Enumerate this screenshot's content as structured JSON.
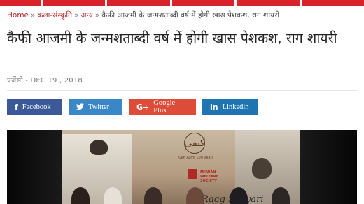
{
  "breadcrumb": {
    "items": [
      "Home",
      "कला-संस्कृति",
      "अन्य",
      "कैफी आजमी के जन्मशताब्दी वर्ष में होगी खास पेशकश, राग शायरी"
    ],
    "separator": "»"
  },
  "article": {
    "title": "कैफी आजमी के जन्मशताब्दी वर्ष में होगी खास पेशकश, राग शायरी",
    "source": "एजेंसी",
    "date": "DEC 19 , 2018"
  },
  "share": {
    "facebook": {
      "label": "Facebook",
      "icon": "f"
    },
    "twitter": {
      "label": "Twitter",
      "icon": "🐦"
    },
    "googleplus": {
      "label": "Google Plus",
      "icon": "G+"
    },
    "linkedin": {
      "label": "Linkedin",
      "icon": "in"
    }
  },
  "photo": {
    "logo_glyph": "کیفی",
    "logo_caption": "Kaifi Azmi 100 years",
    "sponsor_line1": "MUWAN",
    "sponsor_line2": "WELFARE",
    "sponsor_line3": "SOCIETY",
    "stage_text": "Raag Shayari"
  },
  "colors": {
    "topbar": "#d8232a",
    "breadcrumb_link": "#b21f24",
    "facebook": "#3b5998",
    "twitter": "#3a87c8",
    "googleplus": "#dd4b39",
    "linkedin": "#1f75b1"
  }
}
